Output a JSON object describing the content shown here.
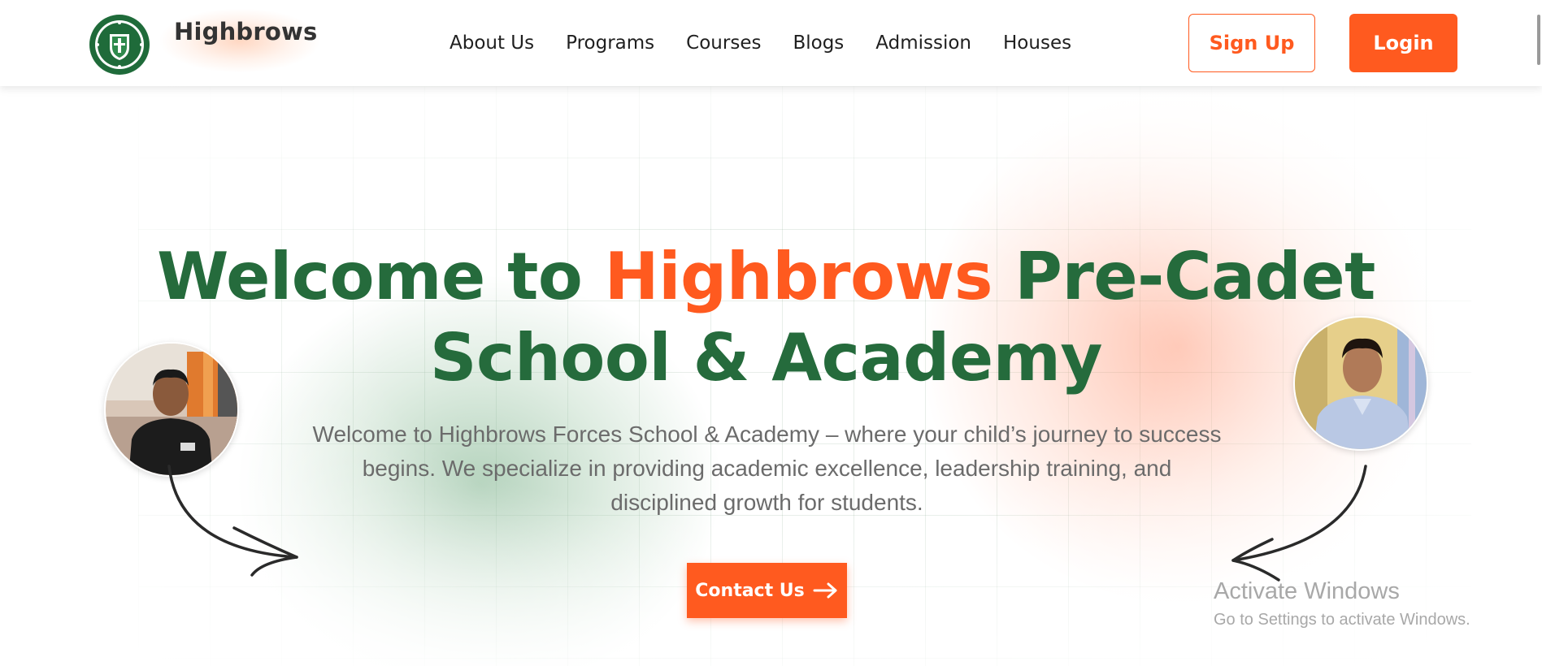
{
  "header": {
    "brand": "Highbrows",
    "logo_icon": "school-crest-icon",
    "nav": [
      {
        "label": "About Us"
      },
      {
        "label": "Programs"
      },
      {
        "label": "Courses"
      },
      {
        "label": "Blogs"
      },
      {
        "label": "Admission"
      },
      {
        "label": "Houses"
      }
    ],
    "signup_label": "Sign Up",
    "login_label": "Login"
  },
  "hero": {
    "title_prefix": "Welcome to ",
    "title_accent": "Highbrows",
    "title_suffix": " Pre-Cadet School & Academy",
    "subtitle": "Welcome to Highbrows Forces School & Academy – where your child’s journey to success begins. We specialize in providing academic excellence, leadership training, and disciplined growth for students.",
    "cta_label": "Contact Us",
    "cta_icon": "arrow-right-icon",
    "left_avatar_icon": "student-photo",
    "right_avatar_icon": "student-photo"
  },
  "watermark": {
    "title": "Activate Windows",
    "subtitle": "Go to Settings to activate Windows."
  },
  "colors": {
    "brand_green": "#256b3c",
    "brand_orange": "#ff5a1f",
    "body_text": "#6b6b6b"
  }
}
